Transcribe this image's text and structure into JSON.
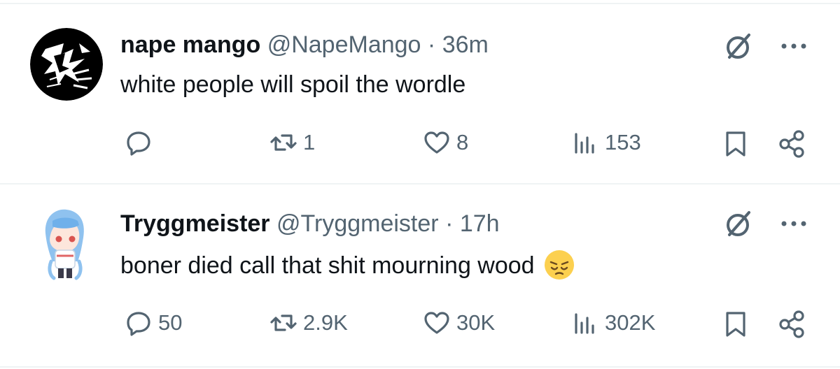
{
  "tweets": [
    {
      "display_name": "nape mango",
      "handle": "@NapeMango",
      "separator": "·",
      "time": "36m",
      "text": "white people will spoil the wordle",
      "emoji": "",
      "avatar": "nape-mango-avatar",
      "replies": "",
      "reposts": "1",
      "likes": "8",
      "views": "153"
    },
    {
      "display_name": "Tryggmeister",
      "handle": "@Tryggmeister",
      "separator": "·",
      "time": "17h",
      "text": "boner died call that shit mourning wood",
      "emoji": "😔",
      "avatar": "tryggmeister-avatar",
      "replies": "50",
      "reposts": "2.9K",
      "likes": "30K",
      "views": "302K"
    }
  ],
  "colors": {
    "text_primary": "#0f1419",
    "text_secondary": "#536471",
    "divider": "#eff3f4"
  },
  "icons": [
    "reply-icon",
    "repost-icon",
    "like-icon",
    "views-icon",
    "bookmark-icon",
    "share-icon",
    "grok-icon",
    "more-icon"
  ]
}
